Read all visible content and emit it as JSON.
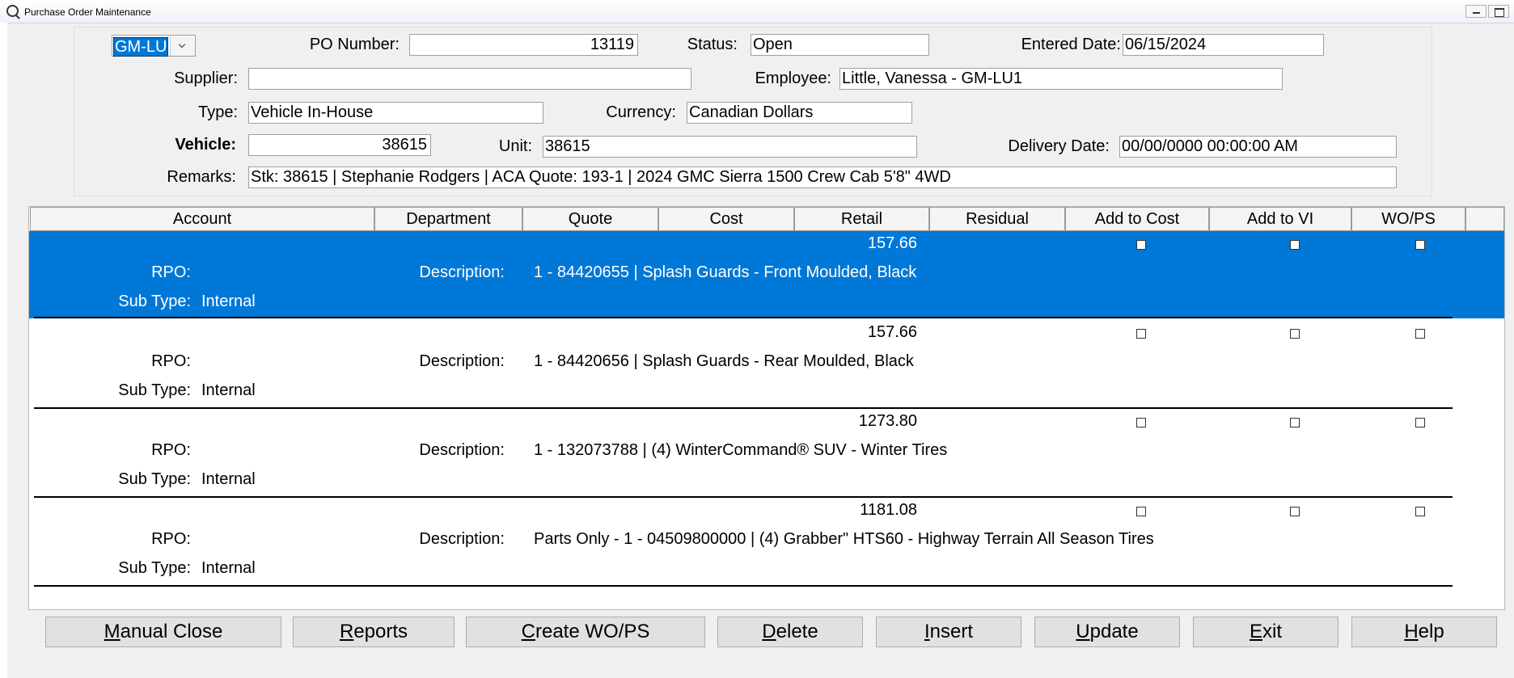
{
  "window": {
    "title": "Purchase Order Maintenance"
  },
  "header": {
    "dealer_combo": "GM-LU",
    "po_number_label": "PO Number:",
    "po_number": "13119",
    "status_label": "Status:",
    "status": "Open",
    "entered_date_label": "Entered Date:",
    "entered_date": "06/15/2024",
    "supplier_label": "Supplier:",
    "supplier": "",
    "employee_label": "Employee:",
    "employee": "Little, Vanessa - GM-LU1",
    "type_label": "Type:",
    "type": "Vehicle In-House",
    "currency_label": "Currency:",
    "currency": "Canadian Dollars",
    "vehicle_label": "Vehicle:",
    "vehicle": "38615",
    "unit_label": "Unit:",
    "unit": "38615",
    "delivery_date_label": "Delivery Date:",
    "delivery_date": "00/00/0000 00:00:00 AM",
    "remarks_label": "Remarks:",
    "remarks": "Stk: 38615 | Stephanie Rodgers | ACA Quote: 193-1 | 2024 GMC Sierra 1500 Crew Cab 5'8\" 4WD"
  },
  "grid": {
    "columns": [
      "Account",
      "Department",
      "Quote",
      "Cost",
      "Retail",
      "Residual",
      "Add to Cost",
      "Add to VI",
      "WO/PS"
    ],
    "rpo_label": "RPO:",
    "description_label": "Description:",
    "subtype_label": "Sub Type:",
    "rows": [
      {
        "retail": "157.66",
        "description": "1 - 84420655 | Splash Guards - Front Moulded, Black",
        "sub_type": "Internal",
        "selected": true
      },
      {
        "retail": "157.66",
        "description": "1 - 84420656 | Splash Guards - Rear Moulded, Black",
        "sub_type": "Internal"
      },
      {
        "retail": "1273.80",
        "description": "1 - 132073788 | (4) WinterCommand® SUV - Winter Tires",
        "sub_type": "Internal"
      },
      {
        "retail": "1181.08",
        "description": "Parts Only - 1 - 04509800000 | (4) Grabber\" HTS60 - Highway Terrain All Season Tires",
        "sub_type": "Internal"
      }
    ]
  },
  "buttons": {
    "manual_close": {
      "key": "M",
      "rest": "anual Close"
    },
    "reports": {
      "key": "R",
      "rest": "eports"
    },
    "create_wops": {
      "key": "C",
      "rest": "reate WO/PS"
    },
    "delete": {
      "key": "D",
      "rest": "elete"
    },
    "insert": {
      "key": "I",
      "rest": "nsert"
    },
    "update": {
      "key": "U",
      "rest": "pdate"
    },
    "exit": {
      "key": "E",
      "rest": "xit"
    },
    "help": {
      "key": "H",
      "rest": "elp"
    }
  },
  "colors": {
    "selection": "#0078d7",
    "window_bg": "#f0f0f0"
  }
}
